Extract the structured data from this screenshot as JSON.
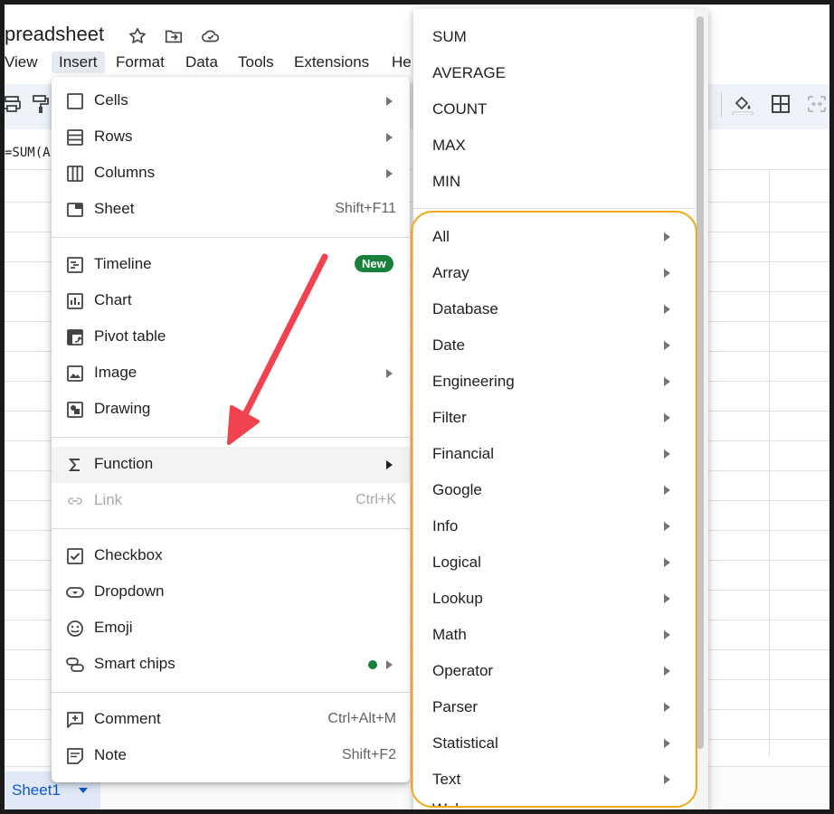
{
  "app": {
    "doc_title": "preadsheet",
    "menubar": [
      "View",
      "Insert",
      "Format",
      "Data",
      "Tools",
      "Extensions",
      "He"
    ],
    "formula": "=SUM(A",
    "sheet_tab": "Sheet1"
  },
  "insert_menu": {
    "items": [
      {
        "label": "Cells",
        "icon": "cells-icon"
      },
      {
        "label": "Rows",
        "icon": "rows-icon"
      },
      {
        "label": "Columns",
        "icon": "columns-icon"
      },
      {
        "label": "Sheet",
        "shortcut": "Shift+F11",
        "icon": "sheet-icon"
      },
      {
        "label": "Timeline",
        "badge": "New",
        "icon": "timeline-icon"
      },
      {
        "label": "Chart",
        "icon": "chart-icon"
      },
      {
        "label": "Pivot table",
        "icon": "pivot-table-icon"
      },
      {
        "label": "Image",
        "icon": "image-icon"
      },
      {
        "label": "Drawing",
        "icon": "drawing-icon"
      },
      {
        "label": "Function",
        "icon": "sigma-icon"
      },
      {
        "label": "Link",
        "shortcut": "Ctrl+K",
        "icon": "link-icon"
      },
      {
        "label": "Checkbox",
        "icon": "checkbox-icon"
      },
      {
        "label": "Dropdown",
        "icon": "dropdown-icon"
      },
      {
        "label": "Emoji",
        "icon": "emoji-icon"
      },
      {
        "label": "Smart chips",
        "icon": "smart-chips-icon"
      },
      {
        "label": "Comment",
        "shortcut": "Ctrl+Alt+M",
        "icon": "comment-icon"
      },
      {
        "label": "Note",
        "shortcut": "Shift+F2",
        "icon": "note-icon"
      }
    ]
  },
  "function_menu": {
    "common": [
      "SUM",
      "AVERAGE",
      "COUNT",
      "MAX",
      "MIN"
    ],
    "categories": [
      "All",
      "Array",
      "Database",
      "Date",
      "Engineering",
      "Filter",
      "Financial",
      "Google",
      "Info",
      "Logical",
      "Lookup",
      "Math",
      "Operator",
      "Parser",
      "Statistical",
      "Text"
    ],
    "cut_off_item": "Web"
  },
  "colors": {
    "highlight_box": "#f2a91e",
    "annotation_arrow": "#f0434f",
    "badge_green": "#188038",
    "accent_blue": "#0b57d0"
  }
}
